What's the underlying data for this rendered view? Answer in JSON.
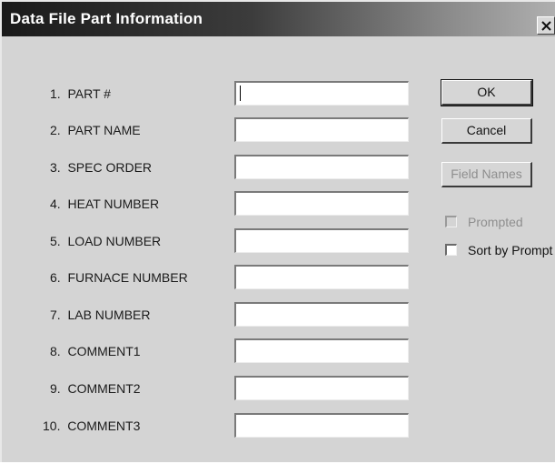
{
  "window": {
    "title": "Data File Part Information"
  },
  "fields": [
    {
      "label": "1.  PART #",
      "value": ""
    },
    {
      "label": "2.  PART NAME",
      "value": ""
    },
    {
      "label": "3.  SPEC ORDER",
      "value": ""
    },
    {
      "label": "4.  HEAT NUMBER",
      "value": ""
    },
    {
      "label": "5.  LOAD NUMBER",
      "value": ""
    },
    {
      "label": "6.  FURNACE NUMBER",
      "value": ""
    },
    {
      "label": "7.  LAB NUMBER",
      "value": ""
    },
    {
      "label": "8.  COMMENT1",
      "value": ""
    },
    {
      "label": "9.  COMMENT2",
      "value": ""
    },
    {
      "label": "10.  COMMENT3",
      "value": ""
    }
  ],
  "buttons": {
    "ok": "OK",
    "cancel": "Cancel",
    "field_names": "Field Names"
  },
  "options": {
    "prompted": {
      "label": "Prompted",
      "checked": false,
      "enabled": false
    },
    "sort_by_prompt": {
      "label": "Sort by Prompt",
      "checked": false,
      "enabled": true
    }
  },
  "icons": {
    "close": "close-icon"
  }
}
